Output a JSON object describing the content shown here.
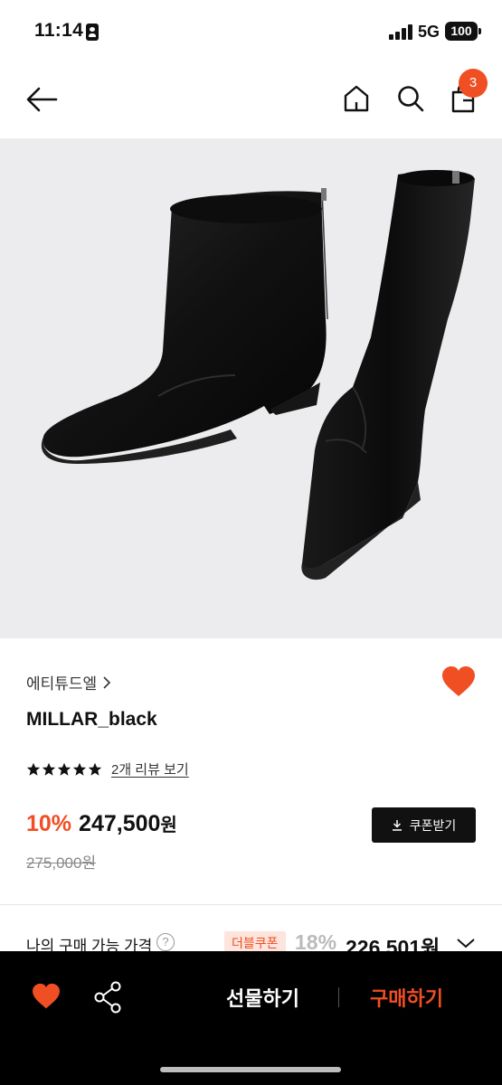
{
  "status_bar": {
    "time": "11:14",
    "network": "5G",
    "battery": "100"
  },
  "header": {
    "cart_count": "3"
  },
  "product": {
    "brand": "에티튜드엘",
    "name": "MILLAR_black",
    "rating_stars": 5,
    "review_link": "2개 리뷰 보기",
    "discount": "10%",
    "price": "247,500",
    "price_unit": "원",
    "original_price": "275,000원",
    "coupon_button": "쿠폰받기"
  },
  "my_price": {
    "label": "나의 구매 가능 가격",
    "help": "?",
    "double_coupon": "더블쿠폰",
    "discount": "18%",
    "price": "226,501원"
  },
  "bottom_bar": {
    "gift": "선물하기",
    "buy": "구매하기"
  },
  "colors": {
    "accent": "#f04e23",
    "image_bg": "#ececee",
    "bottom_bar": "#000000"
  },
  "icons": [
    "back-arrow-icon",
    "home-icon",
    "search-icon",
    "shopping-bag-icon",
    "chevron-right-icon",
    "heart-icon",
    "star-icon",
    "download-icon",
    "help-icon",
    "chevron-down-icon",
    "share-icon"
  ]
}
